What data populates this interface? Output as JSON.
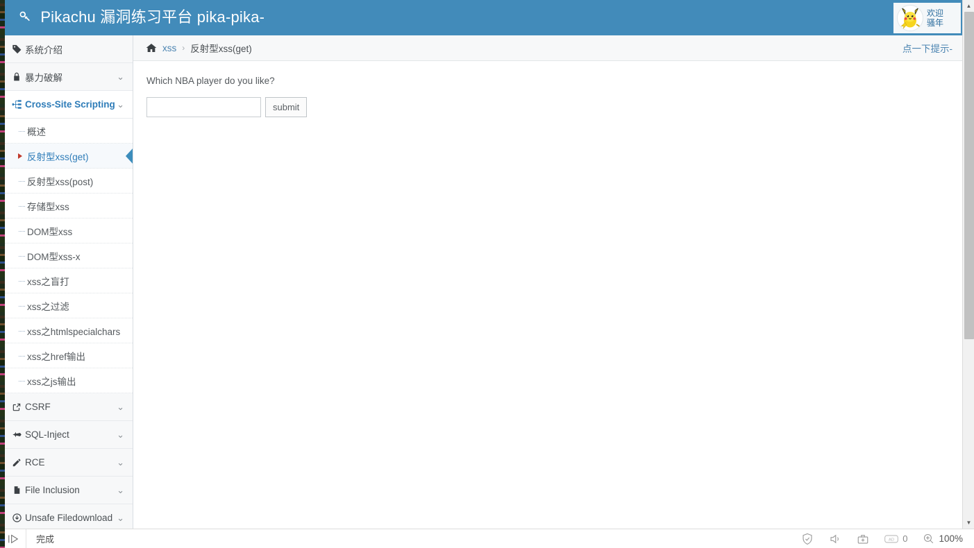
{
  "header": {
    "brand_title": "Pikachu 漏洞练习平台 pika-pika-",
    "brand_icon": "key-icon",
    "welcome_line1": "欢迎",
    "welcome_line2": "骚年",
    "avatar_icon": "pikachu-avatar",
    "bg_color": "#428bba"
  },
  "sidebar": {
    "groups": [
      {
        "label": "系统介绍",
        "icon": "tag-icon",
        "expandable": false,
        "active": false
      },
      {
        "label": "暴力破解",
        "icon": "lock-icon",
        "expandable": true,
        "active": false
      },
      {
        "label": "Cross-Site Scripting",
        "icon": "sitemap-icon",
        "expandable": true,
        "active": true
      }
    ],
    "xss_items": [
      {
        "label": "概述",
        "current": false
      },
      {
        "label": "反射型xss(get)",
        "current": true
      },
      {
        "label": "反射型xss(post)",
        "current": false
      },
      {
        "label": "存储型xss",
        "current": false
      },
      {
        "label": "DOM型xss",
        "current": false
      },
      {
        "label": "DOM型xss-x",
        "current": false
      },
      {
        "label": "xss之盲打",
        "current": false
      },
      {
        "label": "xss之过滤",
        "current": false
      },
      {
        "label": "xss之htmlspecialchars",
        "current": false
      },
      {
        "label": "xss之href输出",
        "current": false
      },
      {
        "label": "xss之js输出",
        "current": false
      }
    ],
    "bottom_groups": [
      {
        "label": "CSRF",
        "icon": "external-link-icon",
        "expandable": true
      },
      {
        "label": "SQL-Inject",
        "icon": "plane-icon",
        "expandable": true
      },
      {
        "label": "RCE",
        "icon": "pencil-icon",
        "expandable": true
      },
      {
        "label": "File Inclusion",
        "icon": "file-icon",
        "expandable": true
      },
      {
        "label": "Unsafe Filedownload",
        "icon": "download-circle-icon",
        "expandable": true
      }
    ],
    "chevron_glyph": "⌄",
    "active_color": "#2e7cb8",
    "pointer_color": "#3c8dbc"
  },
  "breadcrumb": {
    "home_icon": "home-icon",
    "link_label": "xss",
    "separator": "›",
    "current_label": "反射型xss(get)",
    "hint_label": "点一下提示-"
  },
  "main": {
    "question": "Which NBA player do you like?",
    "input_value": "",
    "input_placeholder": "",
    "submit_label": "submit"
  },
  "scrollbar": {
    "up_arrow": "▲",
    "down_arrow": "▼"
  },
  "statusbar": {
    "play_icon": "pause-play-icon",
    "status_text": "完成",
    "shield_icon": "shield-check-icon",
    "sound_icon": "speaker-icon",
    "toolbox_icon": "toolbox-plus-icon",
    "ad_icon": "ad-block-icon",
    "ad_count": "0",
    "zoom_icon": "zoom-in-icon",
    "zoom_level": "100%"
  }
}
